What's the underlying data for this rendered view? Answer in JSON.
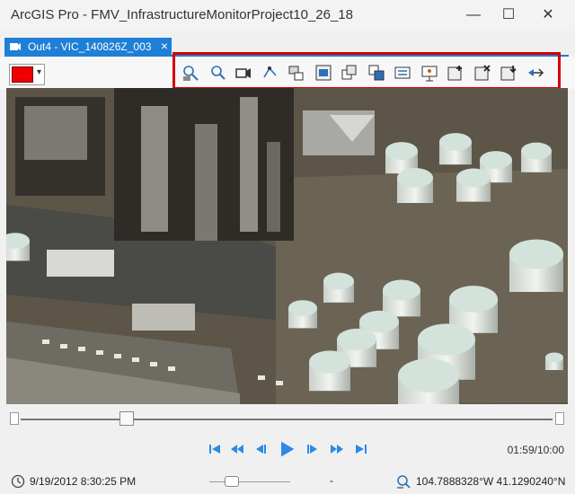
{
  "window": {
    "title": "ArcGIS Pro - FMV_InfrastructureMonitorProject10_26_18",
    "controls": [
      "minimize",
      "maximize",
      "close"
    ]
  },
  "tab": {
    "label": "Out4 - VIC_140826Z_003",
    "close": "×",
    "icon": "fmv-video-icon"
  },
  "toolbar": {
    "color": "#ee0000",
    "icons": [
      "zoom-to-frame-icon",
      "search-frame-icon",
      "video-camera-icon",
      "map-track-icon",
      "frame-export-icon",
      "export-frames-icon",
      "multi-frame-icon",
      "frame-link-icon",
      "video-list-icon",
      "presentation-icon",
      "bookmark-add-icon",
      "bookmark-remove-icon",
      "bookmark-import-icon",
      "measure-icon"
    ]
  },
  "player": {
    "position": 0.2,
    "time": "01:59/10:00",
    "controls": [
      "skip-start-icon",
      "rewind-icon",
      "step-back-icon",
      "play-icon",
      "step-forward-icon",
      "fast-forward-icon",
      "skip-end-icon"
    ]
  },
  "status": {
    "timestamp": "9/19/2012 8:30:25 PM",
    "dash": "-",
    "coordinates": "104.7888328°W 41.1290240°N"
  }
}
